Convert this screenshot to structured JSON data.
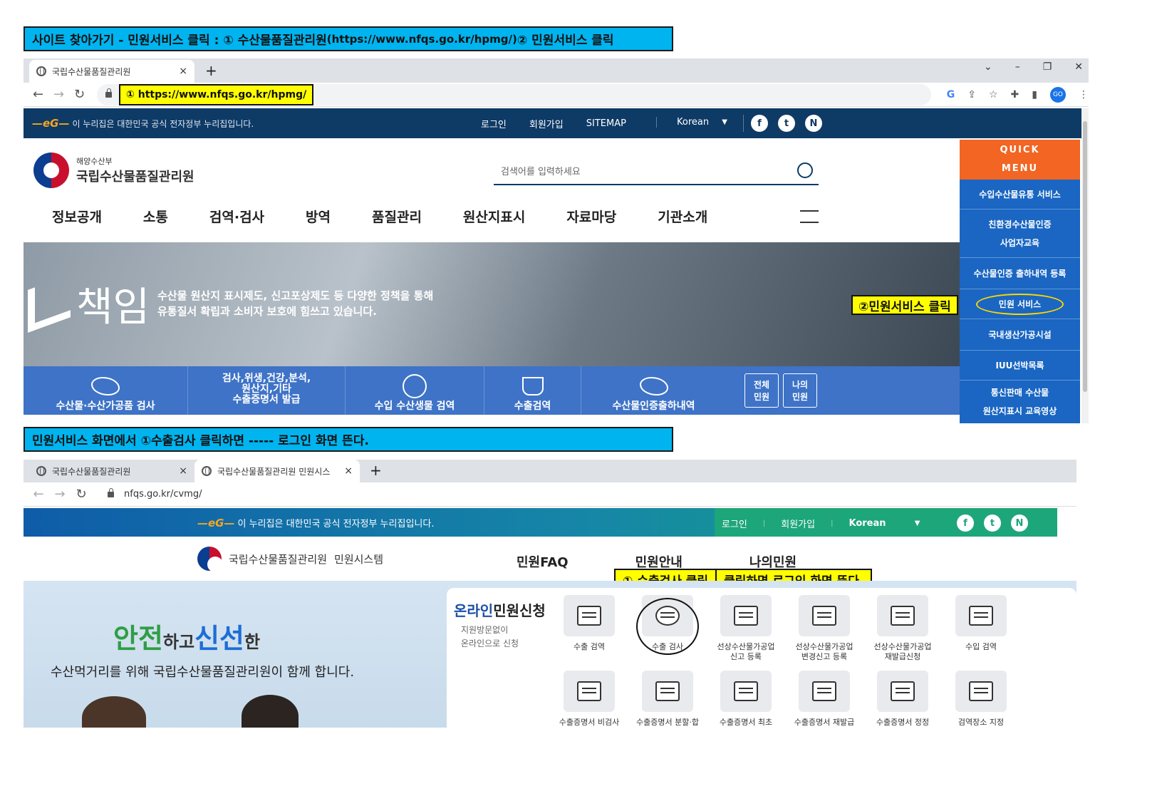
{
  "top_banner": {
    "text": "사이트 찾아가기 - 민원서비스 클릭 : ① 수산물품질관리원 ",
    "url_text": "(https://www.nfqs.go.kr/hpmg/)",
    "tail": " ② 민원서비스 클릭"
  },
  "browser1": {
    "tab_title": "국립수산물품질관리원",
    "new_tab": "+",
    "close": "×",
    "window_controls": [
      "⌄",
      "–",
      "❐",
      "✕"
    ],
    "address_callout": "① https://www.nfqs.go.kr/hpmg/",
    "profile": "GO"
  },
  "site1": {
    "gov_notice": "이 누리집은 대한민국 공식 전자정부 누리집입니다.",
    "util_links": [
      "로그인",
      "회원가입",
      "SITEMAP"
    ],
    "language": "Korean",
    "sns": [
      "f",
      "t",
      "N"
    ],
    "ministry": "해양수산부",
    "org_name": "국립수산물품질관리원",
    "search_placeholder": "검색어를 입력하세요",
    "menu": [
      "정보공개",
      "소통",
      "검역·검사",
      "방역",
      "품질관리",
      "원산지표시",
      "자료마당",
      "기관소개"
    ],
    "hero_word": "책임",
    "hero_line1": "수산물 원산지 표시제도, 신고포상제도 등 다양한 정책을 통해",
    "hero_line2": "유통질서 확립과 소비자 보호에 힘쓰고 있습니다.",
    "shortcuts": [
      "수산물·수산가공품 검사",
      "검사,위생,건강,분석,\n원산지,기타\n수출증명서 발급",
      "수입 수산생물 검역",
      "수출검역",
      "수산물인증출하내역"
    ],
    "mini_buttons": [
      "전체\n민원",
      "나의\n민원"
    ],
    "quick_title": "QUICK\nMENU",
    "quick_items": [
      "수입수산물유통 서비스",
      "친환경수산물인증\n사업자교육",
      "수산물인증 출하내역 등록",
      "민원 서비스",
      "국내생산가공시설",
      "IUU선박목록",
      "통신판매 수산물\n원산지표시 교육영상"
    ],
    "callout": "②민원서비스 클릭"
  },
  "mid_banner": {
    "text": "민원서비스 화면에서 ①수출검사 클릭하면 ----- 로그인 화면 뜬다."
  },
  "browser2": {
    "tab1": "국립수산물품질관리원",
    "tab2": "국립수산물품질관리원 민원시스",
    "new_tab": "+",
    "close": "×",
    "address": "nfqs.go.kr/cvmg/"
  },
  "site2": {
    "gov_notice": "이 누리집은 대한민국 공식 전자정부 누리집입니다.",
    "util_links": [
      "로그인",
      "회원가입"
    ],
    "sep": "|",
    "language": "Korean",
    "sns": [
      "f",
      "t",
      "N"
    ],
    "org_name": "국립수산물품질관리원",
    "system_name": "민원시스템",
    "menu": [
      "민원FAQ",
      "민원안내",
      "나의민원"
    ],
    "callout_a": "① 수출검사 클릭",
    "callout_b": "클릭하면 로그인 화면 뜬다.",
    "hero_slogan_a": "안전",
    "hero_slogan_b": "하고 ",
    "hero_slogan_c": "신선",
    "hero_slogan_d": "한",
    "hero_sub": "수산먹거리를 위해 국립수산물품질관리원이 함께 합니다.",
    "panel_title_a": "온라인",
    "panel_title_b": " 민원신청",
    "panel_sub": "지원방문없이\n온라인으로 신청",
    "services_row1": [
      "수출 검역",
      "수출 검사",
      "선상수산물가공업\n신고 등록",
      "선상수산물가공업\n변경신고 등록",
      "선상수산물가공업\n재발급신청",
      "수입 검역"
    ],
    "services_row2": [
      "수출증명서 비검사",
      "수출증명서 분할·합",
      "수출증명서 최초",
      "수출증명서 재발급",
      "수출증명서 정정",
      "검역장소 지정"
    ]
  },
  "colors": {
    "banner": "#00b4ef",
    "callout": "#ffff00",
    "site1_top": "#0e3a66",
    "quick_header": "#f26522",
    "quick_body": "#1a66c2",
    "shortcut_bar": "#3e73c7"
  }
}
